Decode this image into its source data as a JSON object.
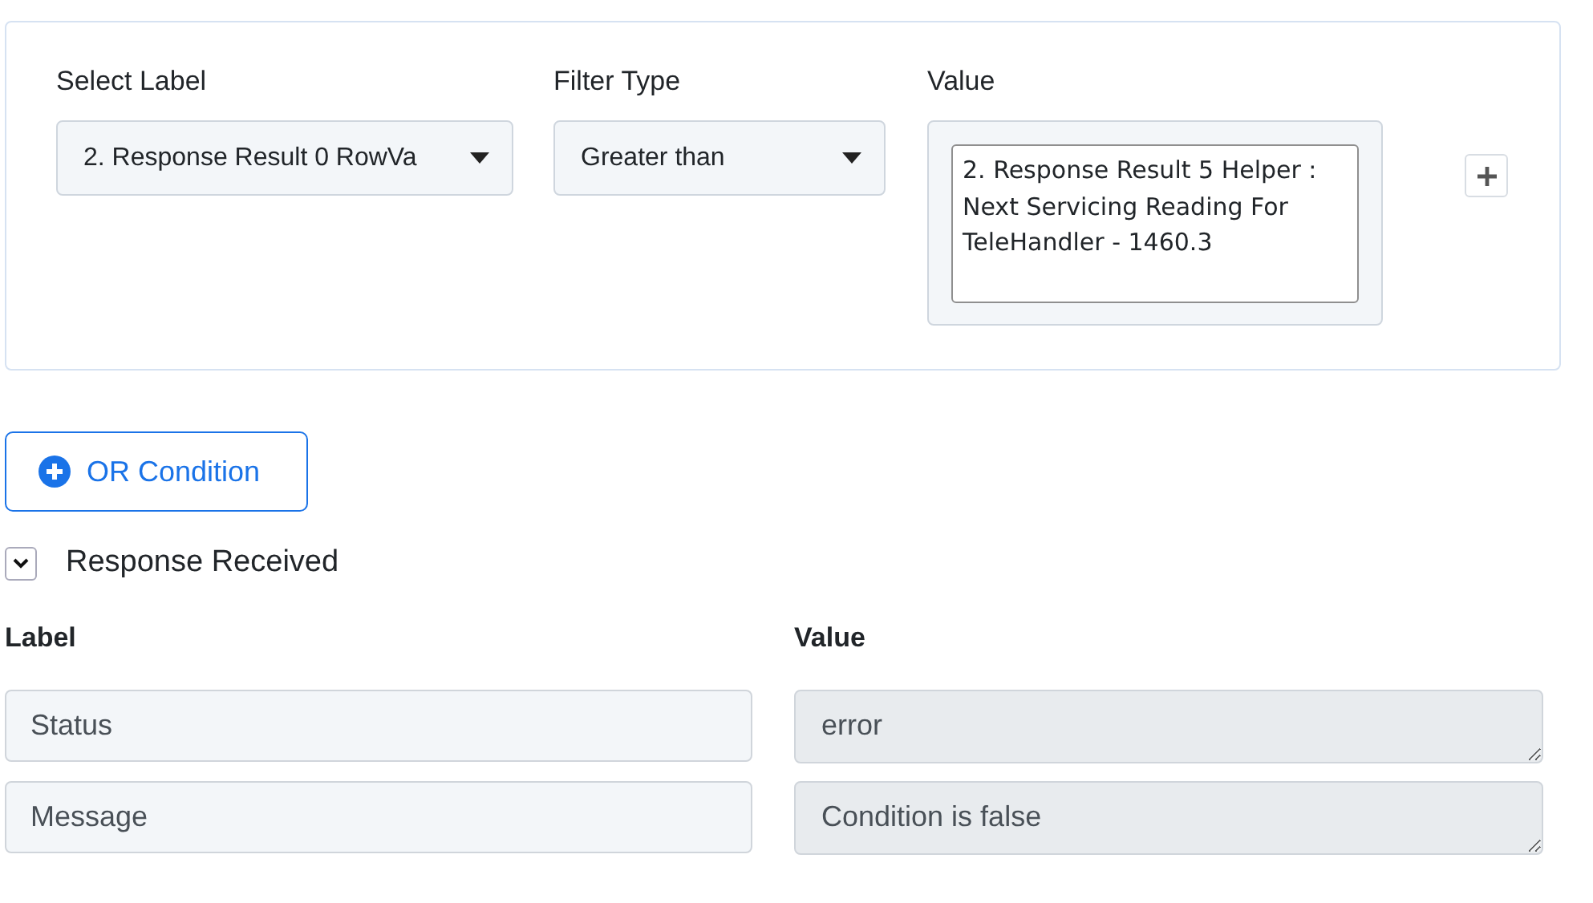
{
  "filter": {
    "select_label": {
      "label": "Select Label",
      "value": "2. Response Result 0 RowVa"
    },
    "filter_type": {
      "label": "Filter Type",
      "value": "Greater than"
    },
    "value": {
      "label": "Value",
      "value": "2. Response Result 5 Helper : Next Servicing Reading For TeleHandler - 1460.3"
    }
  },
  "or_button": "OR Condition",
  "response": {
    "title": "Response Received",
    "expanded": true,
    "label_heading": "Label",
    "value_heading": "Value",
    "rows": [
      {
        "label": "Status",
        "value": "error"
      },
      {
        "label": "Message",
        "value": "Condition is false"
      }
    ]
  }
}
